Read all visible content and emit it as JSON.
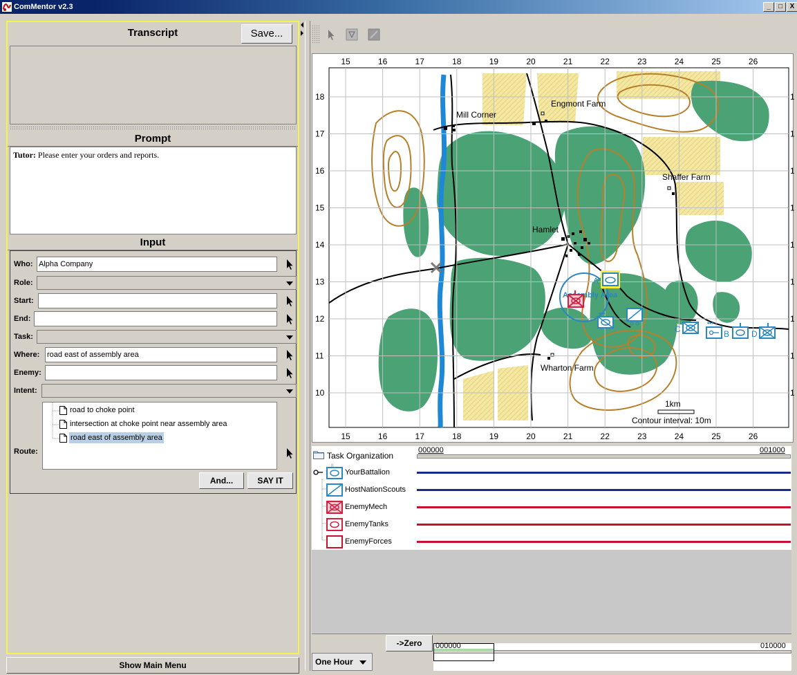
{
  "window": {
    "title": "ComMentor v2.3",
    "buttons": [
      "_",
      "□",
      "X"
    ]
  },
  "transcript": {
    "header": "Transcript",
    "save_label": "Save..."
  },
  "prompt": {
    "header": "Prompt",
    "speaker": "Tutor:",
    "text": " Please enter your orders and reports."
  },
  "input": {
    "header": "Input",
    "fields": {
      "who": {
        "label": "Who:",
        "value": "Alpha Company"
      },
      "role": {
        "label": "Role:",
        "value": ""
      },
      "start": {
        "label": "Start:",
        "value": ""
      },
      "end": {
        "label": "End:",
        "value": ""
      },
      "task": {
        "label": "Task:",
        "value": ""
      },
      "where": {
        "label": "Where:",
        "value": "road east of assembly area"
      },
      "enemy": {
        "label": "Enemy:",
        "value": ""
      },
      "intent": {
        "label": "Intent:",
        "value": ""
      }
    },
    "route": {
      "label": "Route:",
      "items": [
        "road to choke point",
        "intersection at choke point near assembly area",
        "road east of assembly area"
      ],
      "selected_index": 2
    },
    "and_label": "And...",
    "sayit_label": "SAY IT"
  },
  "show_main_menu": "Show Main Menu",
  "map": {
    "x_ticks": [
      "15",
      "16",
      "17",
      "18",
      "19",
      "20",
      "21",
      "22",
      "23",
      "24",
      "25",
      "26"
    ],
    "y_ticks": [
      "18",
      "17",
      "16",
      "15",
      "14",
      "13",
      "12",
      "11",
      "10"
    ],
    "right_tick": "1",
    "place_names": [
      "Mill Corner",
      "Engmont Farm",
      "Shaffer Farm",
      "Hamlet",
      "Wharton Farm",
      "Assembly Area"
    ],
    "unit_letters": [
      "A",
      "B",
      "C",
      "D"
    ],
    "scale_label": "1km",
    "contour_label": "Contour interval: 10m",
    "colors": {
      "forest": "#4aa275",
      "field": "#f3e7a4",
      "contour": "#b77f2a",
      "river": "#1e88d6",
      "friendly": "#2c86c0",
      "enemy": "#d22040",
      "road": "#000000"
    }
  },
  "task_org": {
    "title": "Task Organization",
    "time_start": "000000",
    "time_end": "001000",
    "units": [
      {
        "name": "YourBattalion",
        "side": "friendly"
      },
      {
        "name": "HostNationScouts",
        "side": "friendly"
      },
      {
        "name": "EnemyMech",
        "side": "enemy"
      },
      {
        "name": "EnemyTanks",
        "side": "enemy"
      },
      {
        "name": "EnemyForces",
        "side": "enemy"
      }
    ]
  },
  "bottom": {
    "zero_label": "->Zero",
    "timescale_value": "One Hour",
    "time_start": "000000",
    "time_end": "010000"
  }
}
